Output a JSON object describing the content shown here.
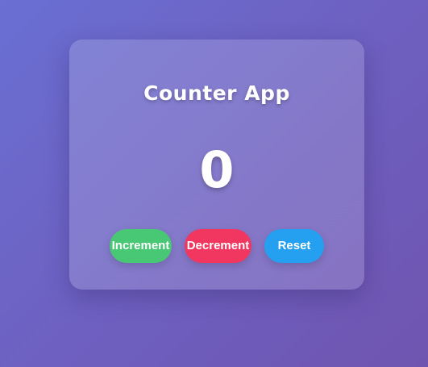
{
  "app": {
    "title": "Counter App",
    "count": "0"
  },
  "buttons": {
    "increment": {
      "label": "Increment",
      "color": "#48c774"
    },
    "decrement": {
      "label": "Decrement",
      "color": "#f1365f"
    },
    "reset": {
      "label": "Reset",
      "color": "#259fef"
    }
  },
  "colors": {
    "background_start": "#6a6fd3",
    "background_end": "#6f55b0",
    "text": "#ffffff"
  }
}
